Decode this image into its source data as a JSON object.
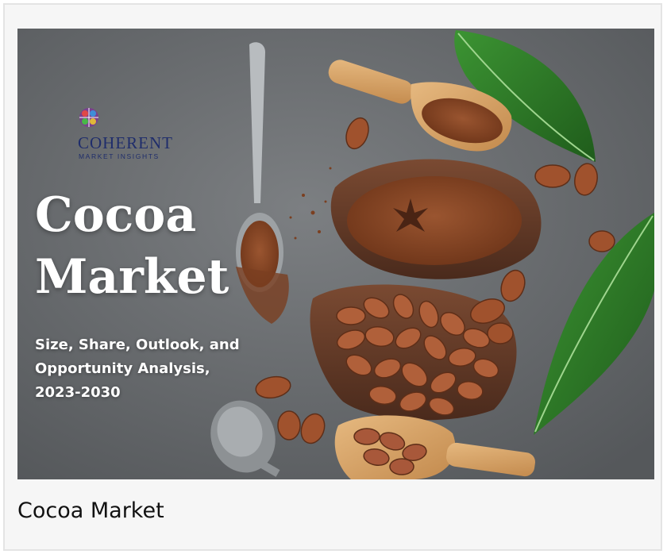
{
  "banner": {
    "logo": {
      "wordmark": "COHERENT",
      "tagline": "MARKET INSIGHTS",
      "icon": "globe-grid-icon"
    },
    "headline_line1": "Cocoa",
    "headline_line2": "Market",
    "subheadline_line1": "Size, Share, Outlook, and",
    "subheadline_line2": "Opportunity Analysis,",
    "subheadline_line3": "2023-2030"
  },
  "caption": "Cocoa Market",
  "colors": {
    "background_stone": "#6f7275",
    "cocoa_powder": "#8a4a26",
    "cocoa_bean": "#a0522d",
    "leaf": "#2f7d2a",
    "wood": "#d9a76c",
    "logo_blue": "#1f2d6b"
  }
}
